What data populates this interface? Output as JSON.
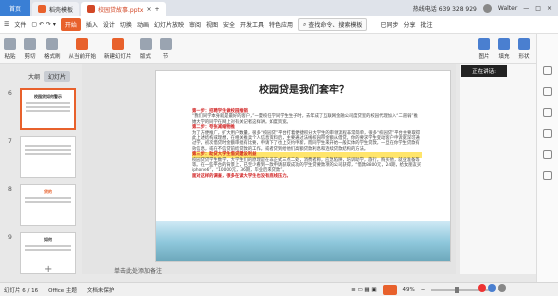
{
  "tabbar": {
    "home": "首页",
    "tab1": "稻壳模板",
    "tab2": "校园贷故事.pptx",
    "phone": "热线电话 639 328 929",
    "user": "Walter"
  },
  "menu": {
    "file": "文件",
    "start": "开始",
    "items": [
      "插入",
      "设计",
      "切换",
      "动画",
      "幻灯片放映",
      "审阅",
      "视图",
      "安全",
      "开发工具",
      "特色应用"
    ],
    "search": "查找命令、搜索模板",
    "sync": "已同步",
    "share": "分享",
    "batch": "批注"
  },
  "ribbon": {
    "paste": "粘贴",
    "cut": "剪切",
    "format": "格式刷",
    "from_start": "从当前开始",
    "new_slide": "新建幻灯片",
    "layout": "版式",
    "section": "节",
    "picture": "图片",
    "fill": "填充",
    "shape": "形状"
  },
  "left": {
    "outline": "大纲",
    "slides": "幻灯片",
    "thumbs": [
      "6",
      "7",
      "8",
      "9"
    ],
    "thumb_titles": [
      "校园贷如何警示",
      "",
      "贷的",
      "如何"
    ]
  },
  "slide": {
    "title": "校园贷是我们套牢？",
    "p1_head": "第一步：招聘学生做校园推销",
    "p1": "“我们同学本身就是最好的客户，”一夏校任学同学生生子时，去年成了互联网金融公司度贷室的校园代理加入“二道弱”推她大学的同学在网上对有关记者这样讲。如度资宽。",
    "p2_head": "第二步：夸张减缩物推",
    "p2": "为了方便推广，扩大用户数量，很多“校园贷”平台打着便捷积分大学生的审领流程非常简单，很多“校园贷”平台主要取得此上述结构或理想，在相关推卖个人信息资料后，主要通过法线校园带金额从借贷。你的要求学生变动客户申诉宽深可通过学，初次借贷时金额审批有比要，申请下了也上交约申新，而同学生来开始一般实体的学生贷款，一旦在你学生贷款有效信息，或在不信贷前结贷款的工作，或者贷到给他们高额贷款利息和连续贷款结构的方法。",
    "p3_head": "第三步：助贷大学生借贷建设利益",
    "p3": "校园贷贷学生数学，大学生们的原理是在非正式三点二处，消费者称，应急陷阱，培训助学，旅行，购买他，就业准备等等。在一些平台的背景上，已至少看到一款申请获取成功的学生贷要款项的公司获得，“借款8800元，24期，给女朋友买iphone6”，“10000元，36期，毕业后来贷款”。",
    "p4": "面对这样的调查，很多在读大学生也没有底线压力。"
  },
  "notes": "单击此处添加备注",
  "status": {
    "slide": "幻灯片 6 / 16",
    "theme": "Office 主题",
    "protect": "文档未保护",
    "zoom": "49%"
  },
  "tooltip": "正在讲话:"
}
